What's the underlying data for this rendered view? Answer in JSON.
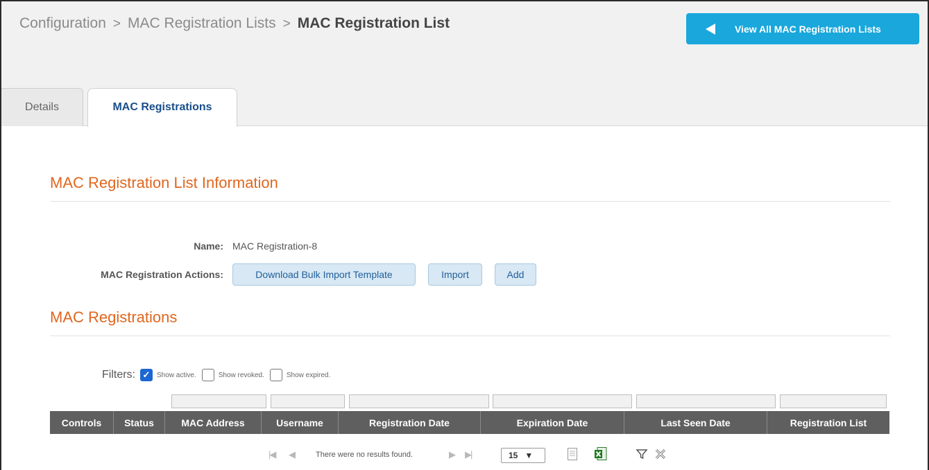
{
  "breadcrumb": {
    "level1": "Configuration",
    "sep1": ">",
    "level2": "MAC Registration Lists",
    "sep2": ">",
    "current": "MAC Registration List"
  },
  "view_all_button": "View All MAC Registration Lists",
  "tabs": [
    {
      "label": "Details",
      "active": false
    },
    {
      "label": "MAC Registrations",
      "active": true
    }
  ],
  "info_section": {
    "title": "MAC Registration List Information",
    "name_label": "Name:",
    "name_value": "MAC Registration-8",
    "actions_label": "MAC Registration Actions:",
    "actions": [
      "Download Bulk Import Template",
      "Import",
      "Add"
    ]
  },
  "registrations_section": {
    "title": "MAC Registrations",
    "filters_label": "Filters:",
    "filters": [
      {
        "label": "Show active.",
        "checked": true
      },
      {
        "label": "Show revoked.",
        "checked": false
      },
      {
        "label": "Show expired.",
        "checked": false
      }
    ],
    "columns": [
      "Controls",
      "Status",
      "MAC Address",
      "Username",
      "Registration Date",
      "Expiration Date",
      "Last Seen Date",
      "Registration List"
    ],
    "rows": []
  },
  "pager": {
    "empty_message": "There were no results found.",
    "page_size": "15",
    "icons": [
      "first-page-icon",
      "prev-page-icon",
      "next-page-icon",
      "last-page-icon",
      "export-csv-icon",
      "export-excel-icon",
      "filter-icon",
      "clear-filter-icon"
    ]
  },
  "colors": {
    "accent_blue": "#19a7dc",
    "section_orange": "#e0661e",
    "header_gray": "#5f5f5f",
    "checkbox_blue": "#1c67d2"
  }
}
